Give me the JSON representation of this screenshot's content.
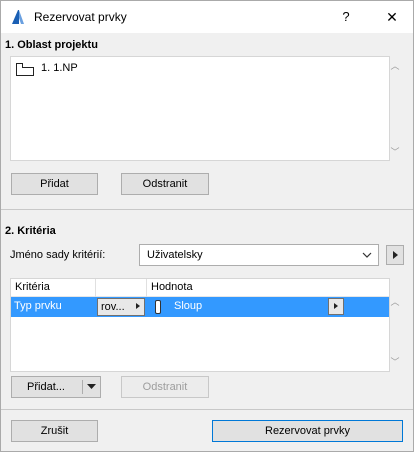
{
  "window": {
    "title": "Rezervovat prvky",
    "help_label": "?",
    "close_label": "✕"
  },
  "area": {
    "heading": "1. Oblast projektu",
    "items": [
      {
        "label": "1. 1.NP"
      }
    ],
    "add_label": "Přidat",
    "remove_label": "Odstranit"
  },
  "criteria": {
    "heading": "2. Kritéria",
    "set_label": "Jméno sady kritérií:",
    "set_value": "Uživatelsky",
    "columns": {
      "criterion": "Kritéria",
      "value": "Hodnota"
    },
    "rows": [
      {
        "criterion": "Typ prvku",
        "operator": "rov...",
        "value": "Sloup"
      }
    ],
    "add_label": "Přidat...",
    "remove_label": "Odstranit"
  },
  "footer": {
    "cancel_label": "Zrušit",
    "reserve_label": "Rezervovat prvky"
  },
  "colors": {
    "selection": "#3399ff",
    "button": "#e1e1e1"
  }
}
